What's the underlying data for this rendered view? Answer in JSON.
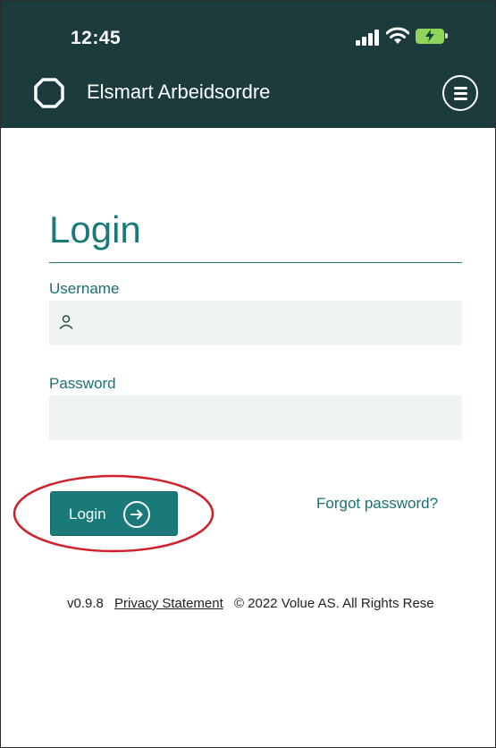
{
  "status_bar": {
    "time": "12:45",
    "icons": [
      "signal-icon",
      "wifi-icon",
      "battery-charging-icon"
    ]
  },
  "app_bar": {
    "title": "Elsmart Arbeidsordre",
    "logo_icon": "octagon-logo-icon",
    "menu_icon": "hamburger-menu-icon"
  },
  "login_form": {
    "title": "Login",
    "username_label": "Username",
    "username_value": "",
    "username_icon": "user-icon",
    "password_label": "Password",
    "password_value": "",
    "login_button_label": "Login",
    "login_button_icon": "arrow-right-circle-icon",
    "forgot_password_link": "Forgot password?"
  },
  "footer": {
    "version": "v0.9.8",
    "privacy_link": "Privacy Statement",
    "copyright": "© 2022 Volue AS. All Rights Rese"
  },
  "colors": {
    "header_bg": "#1c3b3c",
    "accent": "#1a7a7a",
    "input_bg": "#eff3f1",
    "annotation": "#d0202a",
    "battery": "#8fd55a"
  }
}
